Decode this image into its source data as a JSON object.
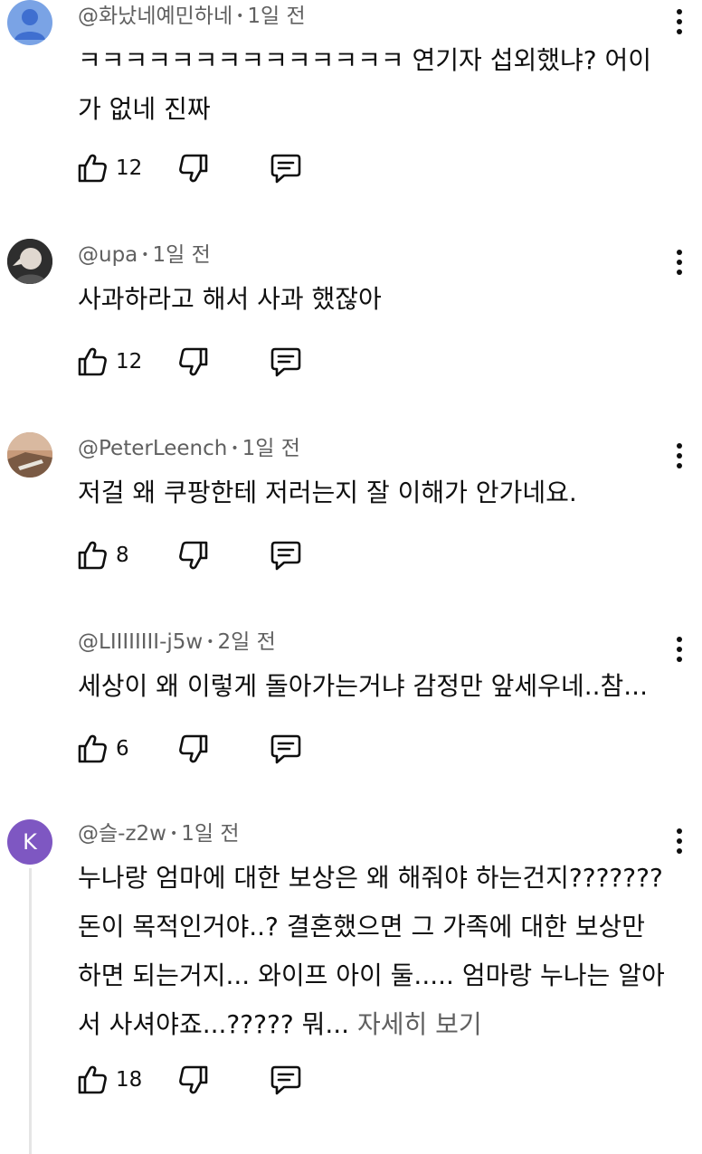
{
  "comments": [
    {
      "author": "@화났네예민하네",
      "time": "1일 전",
      "text": "ㅋㅋㅋㅋㅋㅋㅋㅋㅋㅋㅋㅋㅋㅋ 연기자 섭외했냐? 어이가 없네 진짜",
      "likes": "12",
      "avatar": "default-person-icon",
      "avatar_color": "#7aa3e5"
    },
    {
      "author": "@upa",
      "time": "1일 전",
      "text": "사과하라고 해서 사과 했잖아",
      "likes": "12",
      "avatar": "profile-photo",
      "avatar_color": "#3a3a3a"
    },
    {
      "author": "@PeterLeench",
      "time": "1일 전",
      "text": "저걸 왜 쿠팡한테 저러는지 잘 이해가 안가네요.",
      "likes": "8",
      "avatar": "landscape-photo",
      "avatar_color": "#b88a6a"
    },
    {
      "author": "@LIIIIIIII-j5w",
      "time": "2일 전",
      "text": "세상이 왜 이렇게 돌아가는거냐 감정만 앞세우네..참...",
      "likes": "6",
      "avatar": "none"
    },
    {
      "author": "@슬-z2w",
      "time": "1일 전",
      "text": "누나랑 엄마에 대한 보상은 왜 해줘야 하는건지??????? 돈이 목적인거야..? 결혼했으면 그 가족에 대한 보상만 하면 되는거지... 와이프 아이 둘..... 엄마랑 누나는 알아서 사셔야죠...????? 뭐...",
      "more_label": "자세히 보기",
      "likes": "18",
      "avatar_letter": "K",
      "avatar_color": "#7e57c2"
    }
  ]
}
